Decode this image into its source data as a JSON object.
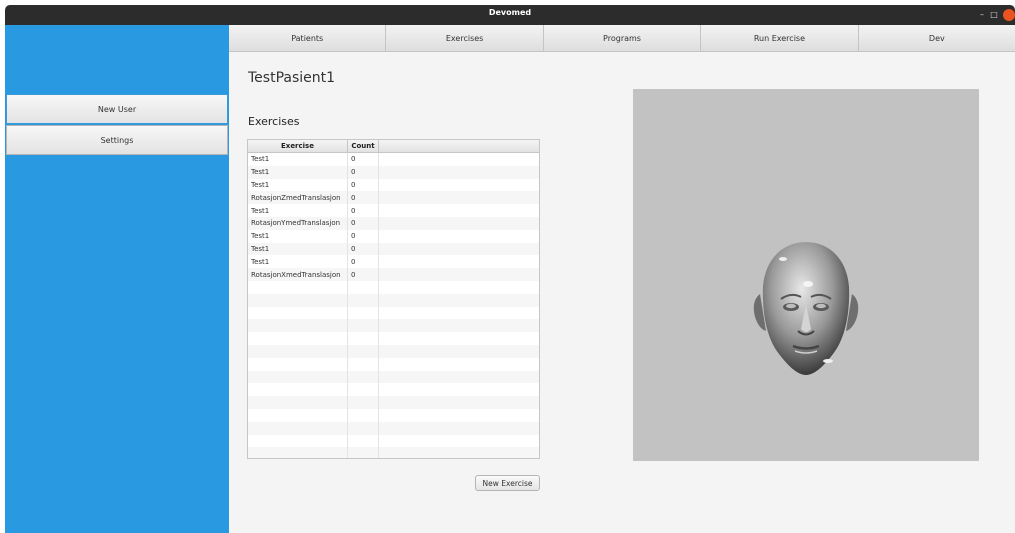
{
  "window": {
    "title": "Devomed",
    "min_glyph": "–",
    "max_glyph": "□",
    "close_glyph": "×"
  },
  "sidebar": {
    "items": [
      {
        "label": "New User"
      },
      {
        "label": "Settings"
      }
    ]
  },
  "nav": {
    "tabs": [
      {
        "label": "Patients"
      },
      {
        "label": "Exercises"
      },
      {
        "label": "Programs"
      },
      {
        "label": "Run Exercise"
      },
      {
        "label": "Dev"
      }
    ]
  },
  "patient": {
    "name": "TestPasient1"
  },
  "exercises": {
    "title": "Exercises",
    "columns": [
      "Exercise",
      "Count"
    ],
    "rows": [
      [
        "Test1",
        "0"
      ],
      [
        "Test1",
        "0"
      ],
      [
        "Test1",
        "0"
      ],
      [
        "RotasjonZmedTranslasjon",
        "0"
      ],
      [
        "Test1",
        "0"
      ],
      [
        "RotasjonYmedTranslasjon",
        "0"
      ],
      [
        "Test1",
        "0"
      ],
      [
        "Test1",
        "0"
      ],
      [
        "Test1",
        "0"
      ],
      [
        "RotasjonXmedTranslasjon",
        "0"
      ]
    ],
    "new_button": "New Exercise"
  },
  "viewer": {
    "content": "3d-head-model"
  },
  "colors": {
    "sidebar": "#2999e2",
    "titlebar": "#2c2c2c",
    "close": "#e95420",
    "viewer_bg": "#c2c2c2"
  }
}
